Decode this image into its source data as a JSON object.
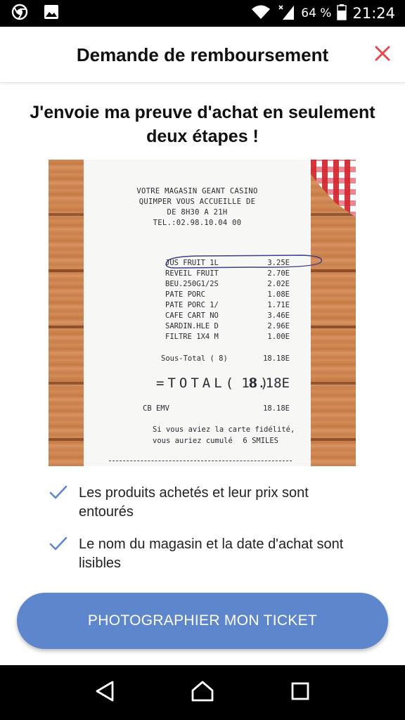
{
  "status_bar": {
    "icons": [
      "chrome-icon",
      "image-icon",
      "wifi-icon",
      "signal-icon",
      "battery-icon"
    ],
    "battery_percent": "64 %",
    "time": "21:24"
  },
  "header": {
    "title": "Demande de remboursement",
    "close_icon": "close-icon",
    "accent_color": "#e5484d"
  },
  "headline": "J'envoie ma preuve d'achat en seulement deux étapes !",
  "receipt": {
    "store_lines": [
      "VOTRE MAGASIN GEANT CASINO",
      "QUIMPER VOUS ACCUEILLE DE",
      "DE 8H30 A 21H",
      "TEL.:02.98.10.04 00"
    ],
    "items": [
      {
        "name": "JUS FRUIT 1L",
        "price": "3.25E"
      },
      {
        "name": "REVEIL FRUIT",
        "price": "2.70E"
      },
      {
        "name": "BEU.250G1/2S",
        "price": "2.02E"
      },
      {
        "name": "PATE PORC",
        "price": "1.08E"
      },
      {
        "name": "PATE PORC 1/",
        "price": "1.71E"
      },
      {
        "name": "CAFE CART NO",
        "price": "3.46E"
      },
      {
        "name": "SARDIN.HLE D",
        "price": "2.96E"
      },
      {
        "name": "FILTRE 1X4 M",
        "price": "1.00E"
      }
    ],
    "subtotal_label": "Sous-Total (   8)",
    "subtotal_value": "18.18E",
    "total_label": "=TOTAL( 8)",
    "total_value": "18.18E",
    "payment_label": "CB EMV",
    "payment_value": "18.18E",
    "footer_line1": "Si vous aviez la carte fidélité,",
    "footer_line2": "vous auriez cumulé",
    "footer_smiles": "6 SMILES"
  },
  "checklist": [
    {
      "icon": "check-icon",
      "text": "Les produits achetés et leur prix sont entourés"
    },
    {
      "icon": "check-icon",
      "text": "Le nom du magasin et la date d'achat sont lisibles"
    }
  ],
  "cta": {
    "label": "PHOTOGRAPHIER MON TICKET",
    "color": "#5e86cd"
  },
  "nav_bar": {
    "icons": [
      "back-icon",
      "home-icon",
      "recents-icon"
    ]
  }
}
